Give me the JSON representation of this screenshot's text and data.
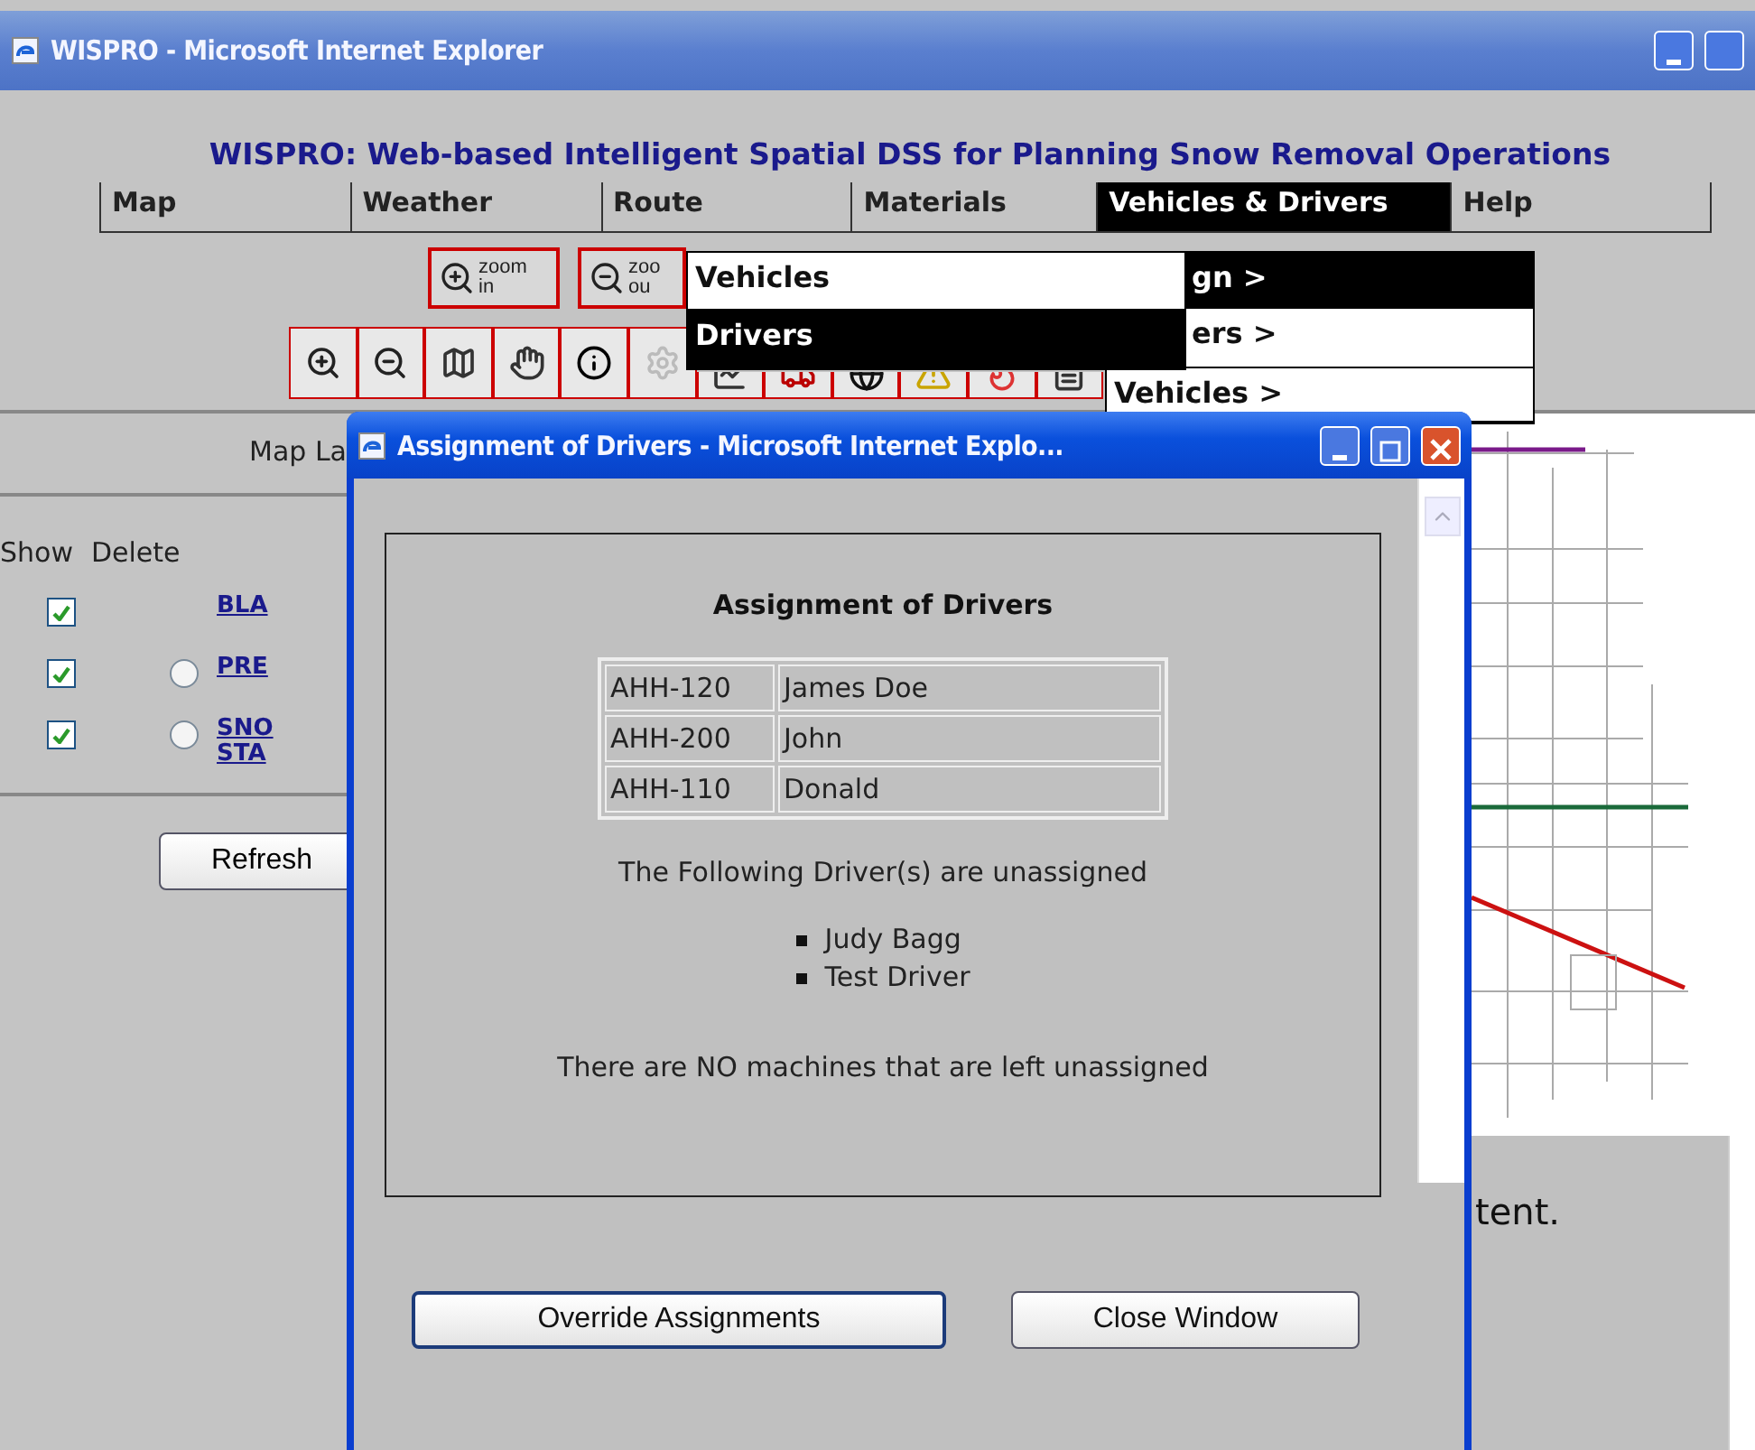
{
  "main_window": {
    "title": "WISPRO - Microsoft Internet Explorer"
  },
  "page": {
    "heading": "WISPRO: Web-based Intelligent Spatial DSS for Planning Snow Removal Operations",
    "menu": [
      {
        "label": "Map",
        "selected": false
      },
      {
        "label": "Weather",
        "selected": false
      },
      {
        "label": "Route",
        "selected": false
      },
      {
        "label": "Materials",
        "selected": false
      },
      {
        "label": "Vehicles & Drivers",
        "selected": true
      },
      {
        "label": "Help",
        "selected": false
      }
    ],
    "menu_dropdown": [
      {
        "label": "gn >",
        "selected": true
      },
      {
        "label": "ers >",
        "selected": false
      },
      {
        "label": "Vehicles >",
        "selected": false
      }
    ],
    "submenu": [
      {
        "label": "Vehicles",
        "selected": false
      },
      {
        "label": "Drivers",
        "selected": true
      }
    ],
    "zoom_buttons": [
      {
        "top": "zoom",
        "bottom": "in",
        "kind": "in"
      },
      {
        "top": "zoo",
        "bottom": "ou",
        "kind": "out"
      }
    ],
    "layers_panel": {
      "title": "Map La",
      "columns": [
        "Show",
        "Delete"
      ],
      "layers": [
        {
          "lines": [
            "BLA"
          ],
          "shown": true,
          "delete_radio": false
        },
        {
          "lines": [
            "PRE"
          ],
          "shown": true,
          "delete_radio": true
        },
        {
          "lines": [
            "SNO",
            "STA"
          ],
          "shown": true,
          "delete_radio": true
        }
      ]
    },
    "refresh_button": "Refresh",
    "content_text": "tent."
  },
  "popup": {
    "title": "Assignment of Drivers - Microsoft Internet Explo...",
    "heading": "Assignment of Drivers",
    "assignments": [
      {
        "vehicle": "AHH-120",
        "driver": "James Doe"
      },
      {
        "vehicle": "AHH-200",
        "driver": "John"
      },
      {
        "vehicle": "AHH-110",
        "driver": "Donald"
      }
    ],
    "unassigned_note": "The Following Driver(s) are unassigned",
    "unassigned_drivers": [
      "Judy Bagg",
      "Test Driver"
    ],
    "machines_note": "There are NO machines that are left unassigned",
    "buttons": [
      {
        "label": "Override Assignments",
        "focused": true
      },
      {
        "label": "Close Window",
        "focused": false
      }
    ]
  }
}
